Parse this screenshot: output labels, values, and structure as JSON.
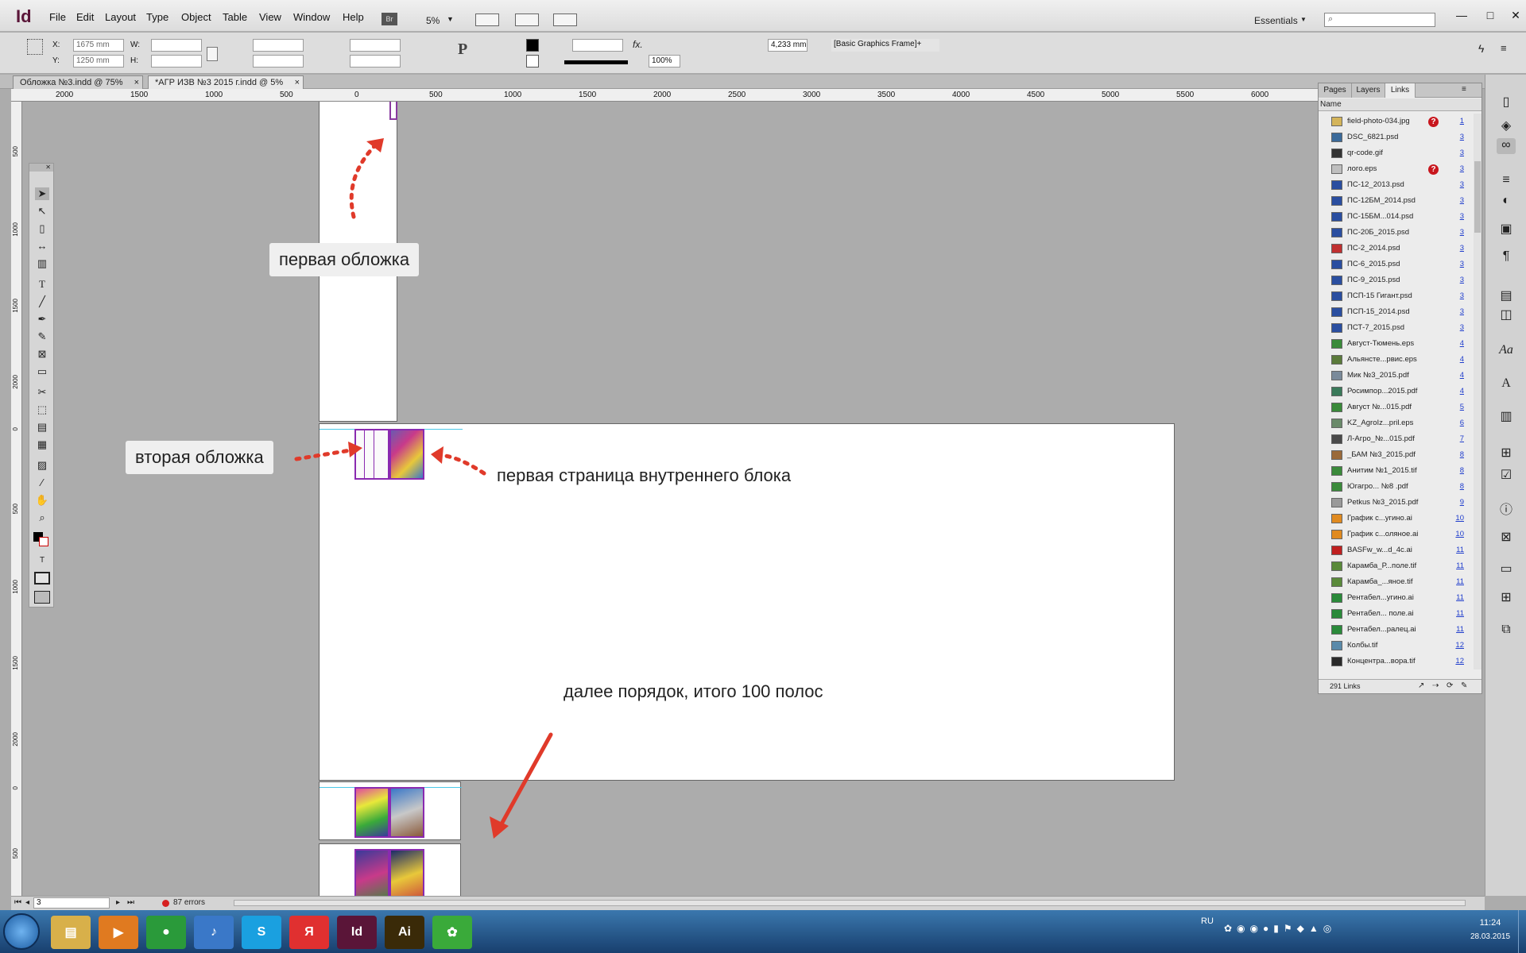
{
  "app": {
    "logo": "Id",
    "zoom": "5%",
    "workspace": "Essentials",
    "bridge": "Br"
  },
  "menu": [
    "File",
    "Edit",
    "Layout",
    "Type",
    "Object",
    "Table",
    "View",
    "Window",
    "Help"
  ],
  "window_controls": {
    "minimize": "—",
    "maximize": "□",
    "close": "✕"
  },
  "control": {
    "x_label": "X:",
    "x_value": "1675 mm",
    "y_label": "Y:",
    "y_value": "1250 mm",
    "w_label": "W:",
    "h_label": "H:",
    "percent": "100%",
    "stroke_weight": "4,233 mm",
    "style": "[Basic Graphics Frame]+"
  },
  "tabs": [
    {
      "label": "Обложка №3.indd @ 75%",
      "close": "×"
    },
    {
      "label": "*АГР ИЗВ №3 2015 г.indd @ 5%",
      "close": "×"
    }
  ],
  "ruler": [
    "2000",
    "1500",
    "1000",
    "500",
    "0",
    "500",
    "1000",
    "1500",
    "2000",
    "2500",
    "3000",
    "3500",
    "4000",
    "4500",
    "5000",
    "5500",
    "6000"
  ],
  "vruler": [
    "500",
    "1000",
    "1500",
    "2000",
    "0",
    "500",
    "1000",
    "1500",
    "2000",
    "0",
    "500"
  ],
  "annotations": {
    "first_cover": "первая обложка",
    "second_cover": "вторая обложка",
    "first_inner_page": "первая страница внутреннего блока",
    "order_note": "далее порядок, итого 100 полос"
  },
  "panel": {
    "tabs": [
      "Pages",
      "Layers",
      "Links"
    ],
    "header": "Name",
    "count": "291 Links",
    "links": [
      {
        "name": "field-photo-034.jpg",
        "page": "1",
        "error": "?",
        "color": "#d4b45a"
      },
      {
        "name": "DSC_6821.psd",
        "page": "3",
        "color": "#3a6a9a"
      },
      {
        "name": "qr-code.gif",
        "page": "3",
        "color": "#333333"
      },
      {
        "name": "лого.eps",
        "page": "3",
        "error": "?",
        "color": "#bfbfbf"
      },
      {
        "name": "ПС-12_2013.psd",
        "page": "3",
        "color": "#2a4ea0"
      },
      {
        "name": "ПС-12БМ_2014.psd",
        "page": "3",
        "color": "#2a4ea0"
      },
      {
        "name": "ПС-15БМ...014.psd",
        "page": "3",
        "color": "#2a4ea0"
      },
      {
        "name": "ПС-20Б_2015.psd",
        "page": "3",
        "color": "#2a4ea0"
      },
      {
        "name": "ПС-2_2014.psd",
        "page": "3",
        "color": "#c03030"
      },
      {
        "name": "ПС-6_2015.psd",
        "page": "3",
        "color": "#2a4ea0"
      },
      {
        "name": "ПС-9_2015.psd",
        "page": "3",
        "color": "#2a4ea0"
      },
      {
        "name": "ПСП-15 Гигант.psd",
        "page": "3",
        "color": "#2a4ea0"
      },
      {
        "name": "ПСП-15_2014.psd",
        "page": "3",
        "color": "#2a4ea0"
      },
      {
        "name": "ПСТ-7_2015.psd",
        "page": "3",
        "color": "#2a4ea0"
      },
      {
        "name": "Август-Тюмень.eps",
        "page": "4",
        "color": "#3a8a3a"
      },
      {
        "name": "Альянсте...рвис.eps",
        "page": "4",
        "color": "#5a7a3a"
      },
      {
        "name": "Мик №3_2015.pdf",
        "page": "4",
        "color": "#7a8a9a"
      },
      {
        "name": "Росимпор...2015.pdf",
        "page": "4",
        "color": "#3a7a5a"
      },
      {
        "name": "Август №...015.pdf",
        "page": "5",
        "color": "#3a8a3a"
      },
      {
        "name": "KZ_AgroIz...pril.eps",
        "page": "6",
        "color": "#6a8a6a"
      },
      {
        "name": "Л-Агро_№...015.pdf",
        "page": "7",
        "color": "#4a4a4a"
      },
      {
        "name": "_БАМ №3_2015.pdf",
        "page": "8",
        "color": "#9a6a3a"
      },
      {
        "name": "Анитим №1_2015.tif",
        "page": "8",
        "color": "#3a8a3a"
      },
      {
        "name": "Югагро... №8 .pdf",
        "page": "8",
        "color": "#3a8a3a"
      },
      {
        "name": "Petkus №3_2015.pdf",
        "page": "9",
        "color": "#9a9a9a"
      },
      {
        "name": "График с...угино.ai",
        "page": "10",
        "color": "#e08a20"
      },
      {
        "name": "График с...оляное.ai",
        "page": "10",
        "color": "#e08a20"
      },
      {
        "name": "BASFw_w...d_4c.ai",
        "page": "11",
        "color": "#c02020"
      },
      {
        "name": "Карамба_Р...поле.tif",
        "page": "11",
        "color": "#5a8a3a"
      },
      {
        "name": "Карамба_...яное.tif",
        "page": "11",
        "color": "#5a8a3a"
      },
      {
        "name": "Рентабел...угино.ai",
        "page": "11",
        "color": "#2a8a3a"
      },
      {
        "name": "Рентабел... поле.ai",
        "page": "11",
        "color": "#2a8a3a"
      },
      {
        "name": "Рентабел...ралец.ai",
        "page": "11",
        "color": "#2a8a3a"
      },
      {
        "name": "Колбы.tif",
        "page": "12",
        "color": "#5a8aaa"
      },
      {
        "name": "Концентра...вора.tif",
        "page": "12",
        "color": "#2a2a2a"
      }
    ]
  },
  "status": {
    "page": "3",
    "errors": "87 errors"
  },
  "taskbar": {
    "apps": [
      {
        "name": "explorer",
        "glyph": "▤",
        "bg": "#d8b04a"
      },
      {
        "name": "media-player",
        "glyph": "▶",
        "bg": "#e07a20"
      },
      {
        "name": "chrome",
        "glyph": "●",
        "bg": "#2a9a3a"
      },
      {
        "name": "audio",
        "glyph": "♪",
        "bg": "#3a78c8"
      },
      {
        "name": "skype",
        "glyph": "S",
        "bg": "#1aa0e0"
      },
      {
        "name": "yandex",
        "glyph": "Я",
        "bg": "#e03030"
      },
      {
        "name": "indesign",
        "glyph": "Id",
        "bg": "#5a1538"
      },
      {
        "name": "illustrator",
        "glyph": "Ai",
        "bg": "#3a2a08"
      },
      {
        "name": "icq",
        "glyph": "✿",
        "bg": "#3aaa3a"
      }
    ],
    "lang": "RU",
    "time": "11:24",
    "date": "28.03.2015"
  }
}
